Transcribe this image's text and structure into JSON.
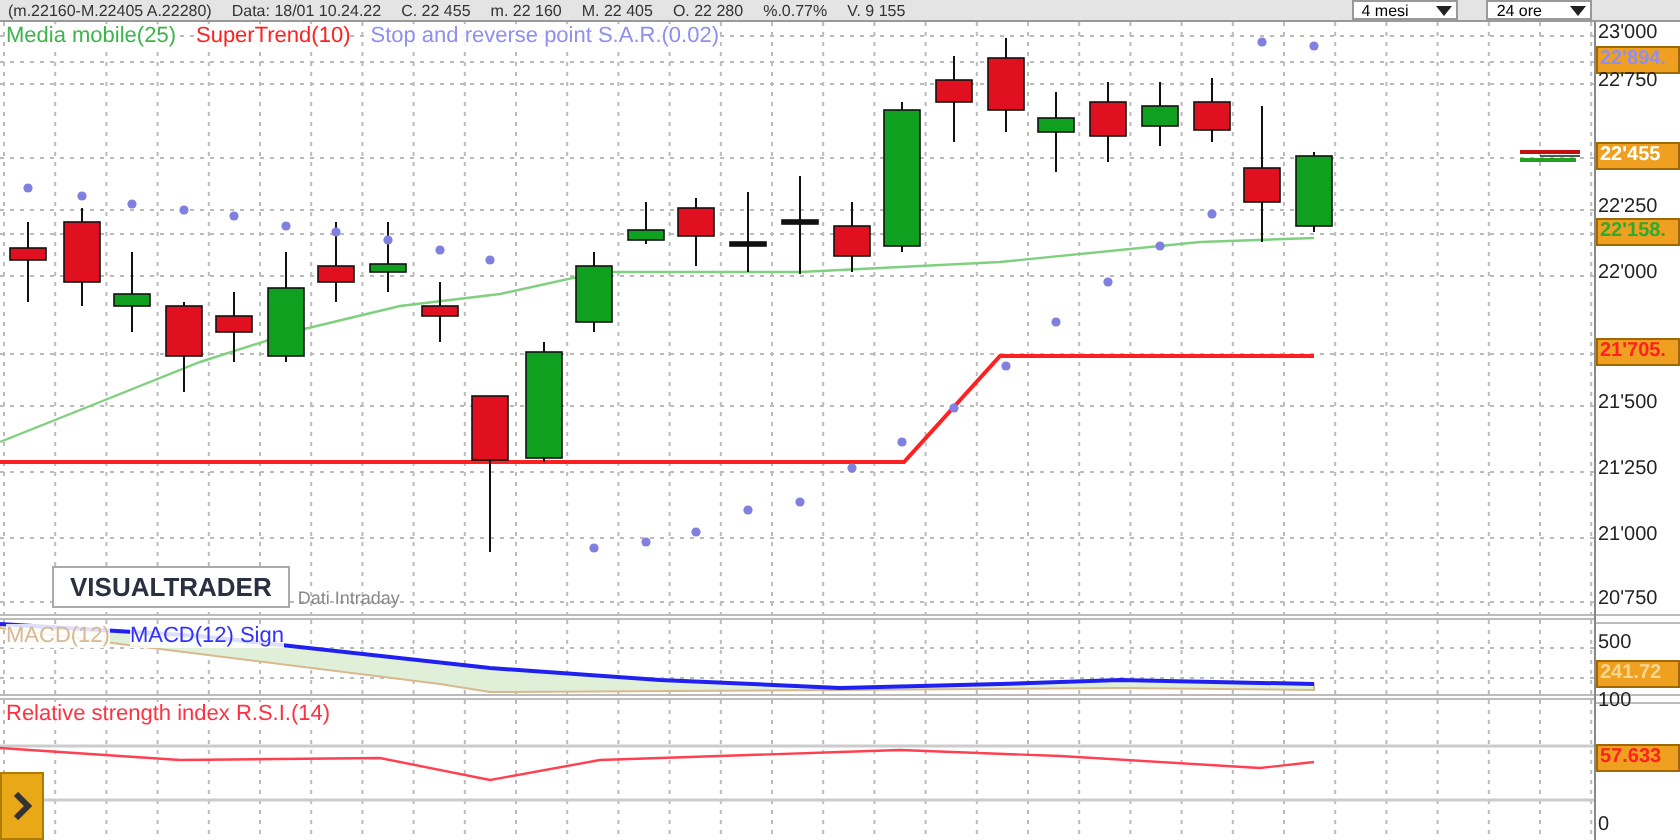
{
  "top_bar": {
    "texts": [
      "(m.22160-M.22405 A.22280)",
      "Data: 18/01 10.24.22",
      "C. 22 455",
      "m. 22 160",
      "M. 22 405",
      "O. 22 280",
      "%.0.77%",
      "V. 9 155"
    ],
    "dropdowns": [
      {
        "label": "4 mesi"
      },
      {
        "label": "24 ore"
      }
    ]
  },
  "main_panel": {
    "legend": [
      {
        "label": "Media mobile(25)",
        "color": "#3cb44b"
      },
      {
        "label": "SuperTrend(10)",
        "color": "#ff2020"
      },
      {
        "label": "Stop and reverse point S.A.R.(0.02)",
        "color": "#8f8fef"
      }
    ],
    "logo": "VISUALTRADER",
    "source": "Dati Intraday",
    "axis": [
      {
        "label": "23'000",
        "kind": "tick"
      },
      {
        "label": "22'894.",
        "kind": "badge",
        "color": "#8f8fef"
      },
      {
        "label": "22'750",
        "kind": "tick"
      },
      {
        "label": "22'455",
        "kind": "badge",
        "color": "#ffffff"
      },
      {
        "label": "22'250",
        "kind": "tick"
      },
      {
        "label": "22'158.",
        "kind": "badge",
        "color": "#2faa2f"
      },
      {
        "label": "22'000",
        "kind": "tick"
      },
      {
        "label": "21'705.",
        "kind": "badge",
        "color": "#ff2020"
      },
      {
        "label": "21'500",
        "kind": "tick"
      },
      {
        "label": "21'250",
        "kind": "tick"
      },
      {
        "label": "21'000",
        "kind": "tick"
      },
      {
        "label": "20'750",
        "kind": "tick"
      }
    ]
  },
  "macd_panel": {
    "legend": [
      {
        "label": "MACD(12)",
        "color": "#d8b890"
      },
      {
        "label": "MACD(12) Sign",
        "color": "#3030ff"
      }
    ],
    "axis": [
      {
        "label": "500",
        "kind": "tick"
      },
      {
        "label": "241.72",
        "kind": "badge",
        "color": "#f4d890"
      }
    ]
  },
  "rsi_panel": {
    "legend": [
      {
        "label": "Relative strength index R.S.I.(14)",
        "color": "#ff3040"
      }
    ],
    "axis": [
      {
        "label": "100",
        "kind": "tick"
      },
      {
        "label": "57.633",
        "kind": "badge",
        "color": "#ff2020"
      },
      {
        "label": "0",
        "kind": "tick"
      }
    ]
  }
}
